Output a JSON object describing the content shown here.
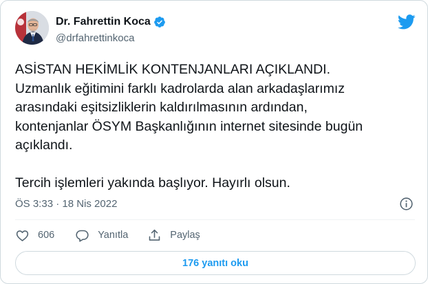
{
  "author": {
    "name": "Dr. Fahrettin Koca",
    "handle": "@drfahrettinkoca",
    "verified": true,
    "avatar_icon": "profile-photo"
  },
  "brand": {
    "icon": "twitter-bird-icon",
    "color": "#1d9bf0"
  },
  "tweet": {
    "lines": [
      "ASİSTAN HEKİMLİK KONTENJANLARI AÇIKLANDI.",
      "Uzmanlık eğitimini farklı kadrolarda alan arkadaşlarımız",
      "arasındaki eşitsizliklerin kaldırılmasının ardından,",
      "kontenjanlar ÖSYM Başkanlığının internet sitesinde bugün",
      "açıklandı."
    ],
    "closing": "Tercih işlemleri yakında başlıyor. Hayırlı olsun.",
    "timestamp": "ÖS 3:33 · 18 Nis 2022"
  },
  "actions": {
    "like_count": "606",
    "reply_label": "Yanıtla",
    "share_label": "Paylaş"
  },
  "replies_button": "176 yanıtı oku",
  "colors": {
    "text": "#0f1419",
    "secondary": "#536471",
    "accent": "#1d9bf0",
    "border": "#cfd9de",
    "like": "#536471"
  }
}
